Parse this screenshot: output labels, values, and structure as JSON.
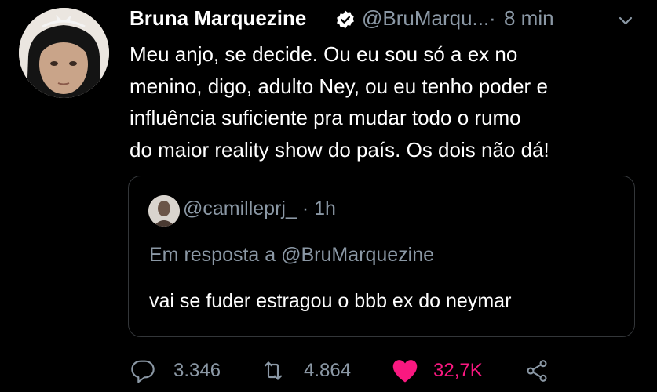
{
  "tweet": {
    "author_name": "Bruna Marquezine",
    "handle": "@BruMarqu...",
    "separator": "·",
    "time": "8 min",
    "text_lines": [
      "Meu anjo, se decide. Ou eu sou só a ex no",
      "menino, digo, adulto Ney, ou eu tenho poder e",
      "influência suficiente pra mudar todo o rumo",
      "do maior reality show do país. Os dois não dá!"
    ]
  },
  "quote": {
    "handle": "@camilleprj_",
    "time_prefix": "·",
    "time": "1h",
    "reply_to": "Em resposta a @BruMarquezine",
    "text": "vai se fuder estragou o bbb ex do neymar"
  },
  "actions": {
    "replies": "3.346",
    "retweets": "4.864",
    "likes": "32,7K"
  },
  "colors": {
    "background": "#000000",
    "text": "#ffffff",
    "muted": "#8b98a5",
    "verified": "#ffffff",
    "like": "#f91880",
    "border": "#333639"
  },
  "icons": {
    "verified": "verified-badge-icon",
    "menu": "chevron-down-icon",
    "reply": "reply-bubble-icon",
    "retweet": "retweet-icon",
    "like": "heart-filled-icon",
    "share": "share-icon"
  }
}
